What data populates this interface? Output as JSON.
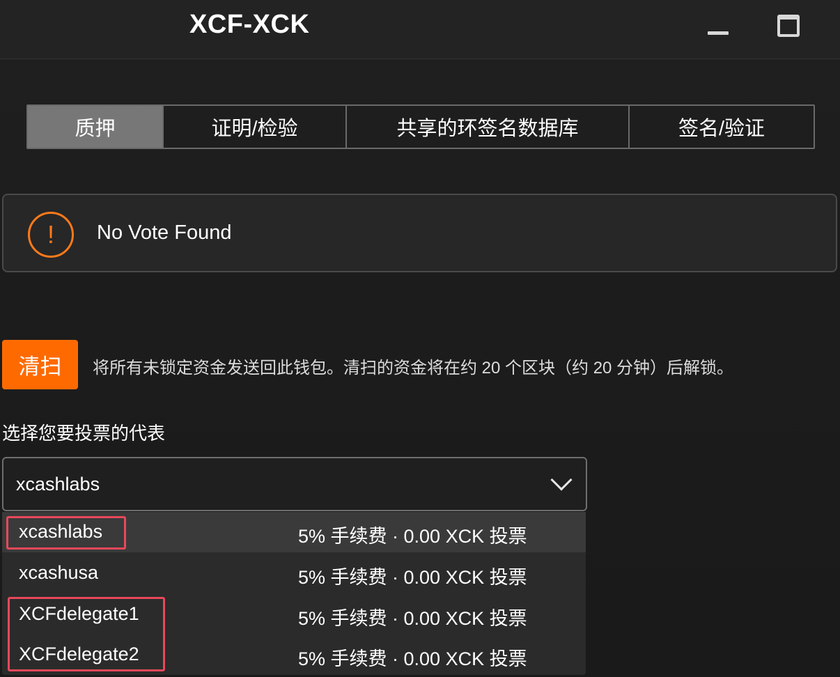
{
  "window": {
    "title": "XCF-XCK",
    "minimize_icon": "minimize-icon",
    "maximize_icon": "maximize-icon"
  },
  "tabs": [
    {
      "label": "质押",
      "active": true
    },
    {
      "label": "证明/检验",
      "active": false
    },
    {
      "label": "共享的环签名数据库",
      "active": false
    },
    {
      "label": "签名/验证",
      "active": false
    }
  ],
  "alert": {
    "icon": "exclamation-circle-icon",
    "icon_glyph": "!",
    "message": "No Vote Found",
    "accent_color": "#ff7a1a"
  },
  "sweep": {
    "button_label": "清扫",
    "description": "将所有未锁定资金发送回此钱包。清扫的资金将在约 20 个区块（约 20 分钟）后解锁。",
    "button_color": "#ff6a00"
  },
  "delegate_select": {
    "label": "选择您要投票的代表",
    "selected": "xcashlabs",
    "chevron_icon": "chevron-down-icon",
    "options": [
      {
        "name": "xcashlabs",
        "meta": "5% 手续费 · 0.00 XCK 投票",
        "highlighted": true
      },
      {
        "name": "xcashusa",
        "meta": "5% 手续费 · 0.00 XCK 投票",
        "highlighted": false
      },
      {
        "name": "XCFdelegate1",
        "meta": "5% 手续费 · 0.00 XCK 投票",
        "highlighted": false
      },
      {
        "name": "XCFdelegate2",
        "meta": "5% 手续费 · 0.00 XCK 投票",
        "highlighted": false
      }
    ]
  },
  "annotation_color": "#e8485a"
}
